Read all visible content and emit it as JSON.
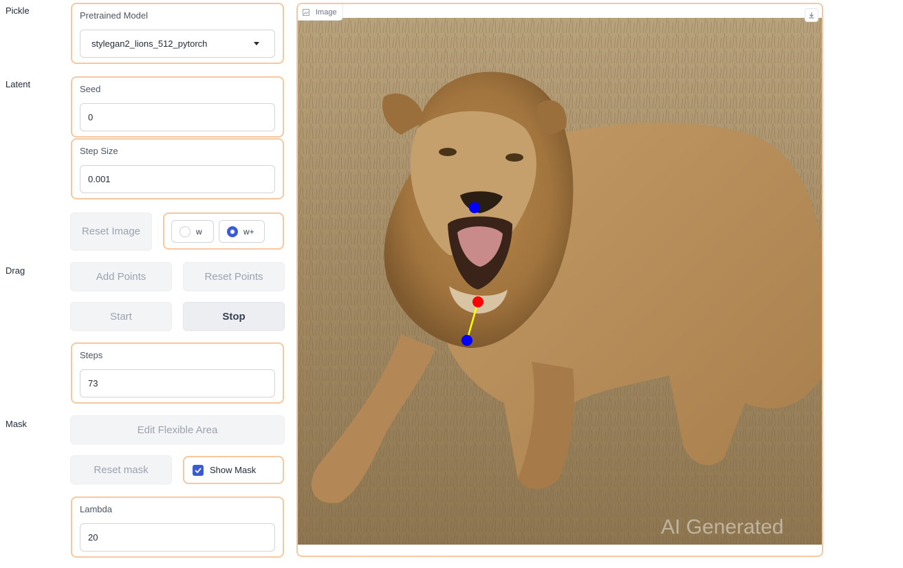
{
  "sections": {
    "pickle": "Pickle",
    "latent": "Latent",
    "drag": "Drag",
    "mask": "Mask"
  },
  "pretrained_model": {
    "label": "Pretrained Model",
    "value": "stylegan2_lions_512_pytorch"
  },
  "seed": {
    "label": "Seed",
    "value": "0"
  },
  "step_size": {
    "label": "Step Size",
    "value": "0.001"
  },
  "buttons": {
    "reset_image": "Reset Image",
    "add_points": "Add Points",
    "reset_points": "Reset Points",
    "start": "Start",
    "stop": "Stop",
    "edit_flexible_area": "Edit Flexible Area",
    "reset_mask": "Reset mask"
  },
  "latent_space": {
    "options": [
      "w",
      "w+"
    ],
    "selected": "w+"
  },
  "steps": {
    "label": "Steps",
    "value": "73"
  },
  "show_mask": {
    "label": "Show Mask",
    "checked": true
  },
  "lambda": {
    "label": "Lambda",
    "value": "20"
  },
  "image_panel": {
    "label": "Image",
    "watermark": "AI Generated"
  },
  "colors": {
    "accent_border": "#f6c89f",
    "checkbox_blue": "#3b5bd6",
    "handle_point": "#0000ff",
    "target_point": "#ff0000",
    "drag_line": "#ffff00"
  }
}
